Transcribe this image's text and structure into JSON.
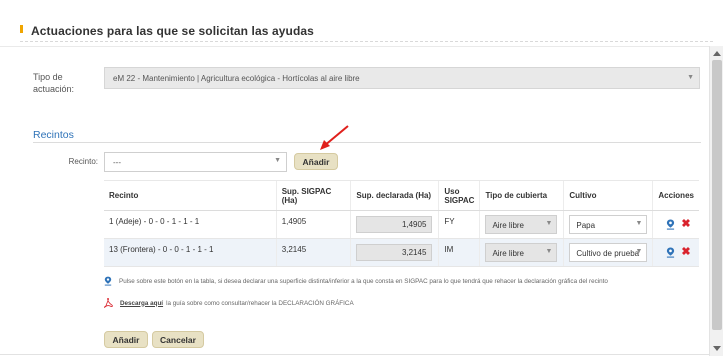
{
  "section": {
    "title": "Actuaciones para las que se solicitan las ayudas"
  },
  "tipo": {
    "label": "Tipo de actuación:",
    "value": "eM 22 - Mantenimiento | Agricultura ecológica - Hortícolas al aire libre"
  },
  "recintos": {
    "title": "Recintos",
    "select_label": "Recinto:",
    "select_value": "---",
    "add_label": "Añadir"
  },
  "table": {
    "headers": {
      "recinto": "Recinto",
      "sup_sigpac": "Sup. SIGPAC (Ha)",
      "sup_declarada": "Sup. declarada (Ha)",
      "uso": "Uso SIGPAC",
      "tipo_cubierta": "Tipo de cubierta",
      "cultivo": "Cultivo",
      "acciones": "Acciones"
    },
    "rows": [
      {
        "recinto": "1 (Adeje) - 0 - 0 - 1 - 1 - 1",
        "sup_sigpac": "1,4905",
        "sup_declarada": "1,4905",
        "uso": "FY",
        "tipo_cubierta": "Aire libre",
        "cultivo": "Papa"
      },
      {
        "recinto": "13 (Frontera) - 0 - 0 - 1 - 1 - 1",
        "sup_sigpac": "3,2145",
        "sup_declarada": "3,2145",
        "uso": "IM",
        "tipo_cubierta": "Aire libre",
        "cultivo": "Cultivo de prueba"
      }
    ]
  },
  "notes": {
    "pin_text": "Pulse sobre este botón en la tabla, si desea declarar una superficie distinta/inferior a la que consta en SIGPAC para lo que tendrá que rehacer la declaración gráfica del recinto",
    "download_link": "Descarga aquí",
    "download_text": "la guía sobre como consultar/rehacer la DECLARACIÓN GRÁFICA"
  },
  "footer": {
    "add_label": "Añadir",
    "cancel_label": "Cancelar"
  },
  "colors": {
    "accent": "#2f73b8",
    "button": "#e8e1c4",
    "danger": "#d9232d",
    "highlight_arrow": "#e0201c"
  }
}
